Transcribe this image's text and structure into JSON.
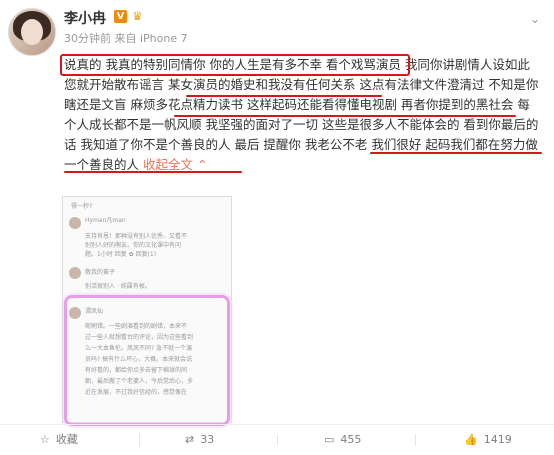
{
  "post": {
    "author": "李小冉",
    "verified_badge": "V",
    "meta": "30分钟前 来自 iPhone 7",
    "content_before": "说真的 我真的特别同情你 你的人生是有多不幸 看个戏骂演员 我同你讲剧情人设如此 您就开始散布谣言 某女演员的婚史和我没有任何关系 这点有法律文件澄清过 不知是你瞎还是文盲 麻烦多花点精力读书 这样起码还能看得懂电视剧 再者你提到的黑社会 每个人成长都不是一帆风顺 我坚强的面对了一切 这些是很多人不能体会的 看到你最后的话 我知道了你不是个善良的人 最后 提醒你 我老公不老 我们很好 起码我们都在努力做一个善良的人",
    "expand_label": "收起全文"
  },
  "screenshot": {
    "lines": [
      "得一秒?",
      "Hyman凡man",
      "支持肖恩！那种没有别人优秀、又看不",
      "别别人好的啊友。你的文化课中有问",
      "题。1小时 回复 ✿ 回复(1)",
      "敬我的黄子",
      "别活很别人 · 纯属有帧。",
      "谭凤仙",
      "呢刷错。一些剧演看到的剧错，本来不",
      "过一些人就想看台的评论，因为这些看到",
      "么一大本鱼伦。凤凤不同? 急不就一个演",
      "员吗? 搞有什么坏心，大概。本来就会说",
      "有好看的，都给你点多去留下棉球的同",
      "朝，最后搬了个老婆人，今后觉后心，多",
      "近在发展，不过我好信经的，感觉像在"
    ]
  },
  "actions": {
    "favorite": "收藏",
    "repost": "33",
    "comment": "455",
    "like": "1419"
  },
  "colors": {
    "highlight_red": "#d4181b",
    "expand_orange": "#eb7350",
    "pink_circle": "#e79ee8"
  },
  "icons": [
    "star-icon",
    "repost-icon",
    "comment-icon",
    "like-icon",
    "chevron-down-icon"
  ]
}
